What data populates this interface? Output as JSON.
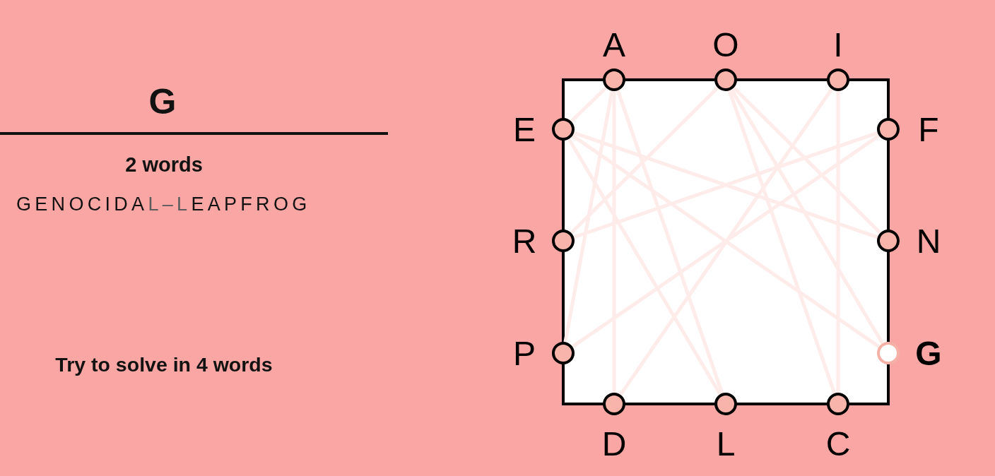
{
  "entry": {
    "letters": "G"
  },
  "progress": {
    "count": "2 words",
    "chain": [
      {
        "text": "GENOCIDA",
        "joint": false
      },
      {
        "text": "L–L",
        "joint": true
      },
      {
        "text": "EAPFROG",
        "joint": false
      }
    ]
  },
  "goal": "Try to solve in 4 words",
  "board": {
    "sides": [
      {
        "kind": "top",
        "letters": [
          {
            "letter": "A",
            "used": true,
            "selected": false
          },
          {
            "letter": "O",
            "used": true,
            "selected": false
          },
          {
            "letter": "I",
            "used": true,
            "selected": false
          }
        ]
      },
      {
        "kind": "right",
        "letters": [
          {
            "letter": "F",
            "used": true,
            "selected": false
          },
          {
            "letter": "N",
            "used": true,
            "selected": false
          },
          {
            "letter": "G",
            "used": true,
            "selected": true
          }
        ]
      },
      {
        "kind": "bottom",
        "letters": [
          {
            "letter": "D",
            "used": true,
            "selected": false
          },
          {
            "letter": "L",
            "used": true,
            "selected": false
          },
          {
            "letter": "C",
            "used": true,
            "selected": false
          }
        ]
      },
      {
        "kind": "left",
        "letters": [
          {
            "letter": "E",
            "used": true,
            "selected": false
          },
          {
            "letter": "R",
            "used": true,
            "selected": false
          },
          {
            "letter": "P",
            "used": true,
            "selected": false
          }
        ]
      }
    ]
  }
}
